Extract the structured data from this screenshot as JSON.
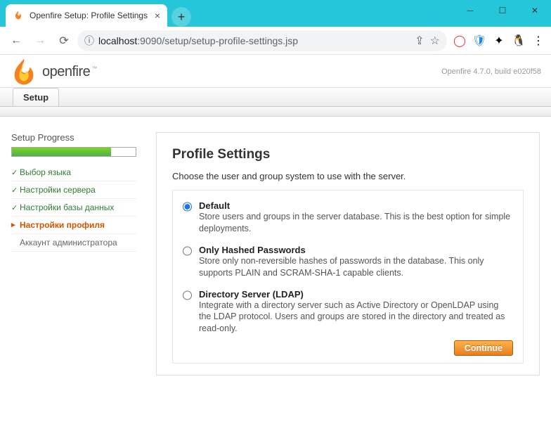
{
  "browser": {
    "tab_title": "Openfire Setup: Profile Settings",
    "url_host": "localhost",
    "url_port": ":9090",
    "url_path": "/setup/setup-profile-settings.jsp"
  },
  "header": {
    "logo_name": "openfire",
    "version": "Openfire 4.7.0, build e020f58"
  },
  "tabs": {
    "setup_label": "Setup"
  },
  "sidebar": {
    "progress_title": "Setup Progress",
    "progress_pct": 80,
    "steps": [
      {
        "label": "Выбор языка",
        "state": "done"
      },
      {
        "label": "Настройки сервера",
        "state": "done"
      },
      {
        "label": "Настройки базы данных",
        "state": "done"
      },
      {
        "label": "Настройки профиля",
        "state": "current"
      },
      {
        "label": "Аккаунт администратора",
        "state": "pending"
      }
    ]
  },
  "main": {
    "heading": "Profile Settings",
    "intro": "Choose the user and group system to use with the server.",
    "options": [
      {
        "title": "Default",
        "desc": "Store users and groups in the server database. This is the best option for simple deployments.",
        "checked": true
      },
      {
        "title": "Only Hashed Passwords",
        "desc": "Store only non-reversible hashes of passwords in the database. This only supports PLAIN and SCRAM-SHA-1 capable clients.",
        "checked": false
      },
      {
        "title": "Directory Server (LDAP)",
        "desc": "Integrate with a directory server such as Active Directory or OpenLDAP using the LDAP protocol. Users and groups are stored in the directory and treated as read-only.",
        "checked": false
      }
    ],
    "continue_label": "Continue"
  }
}
